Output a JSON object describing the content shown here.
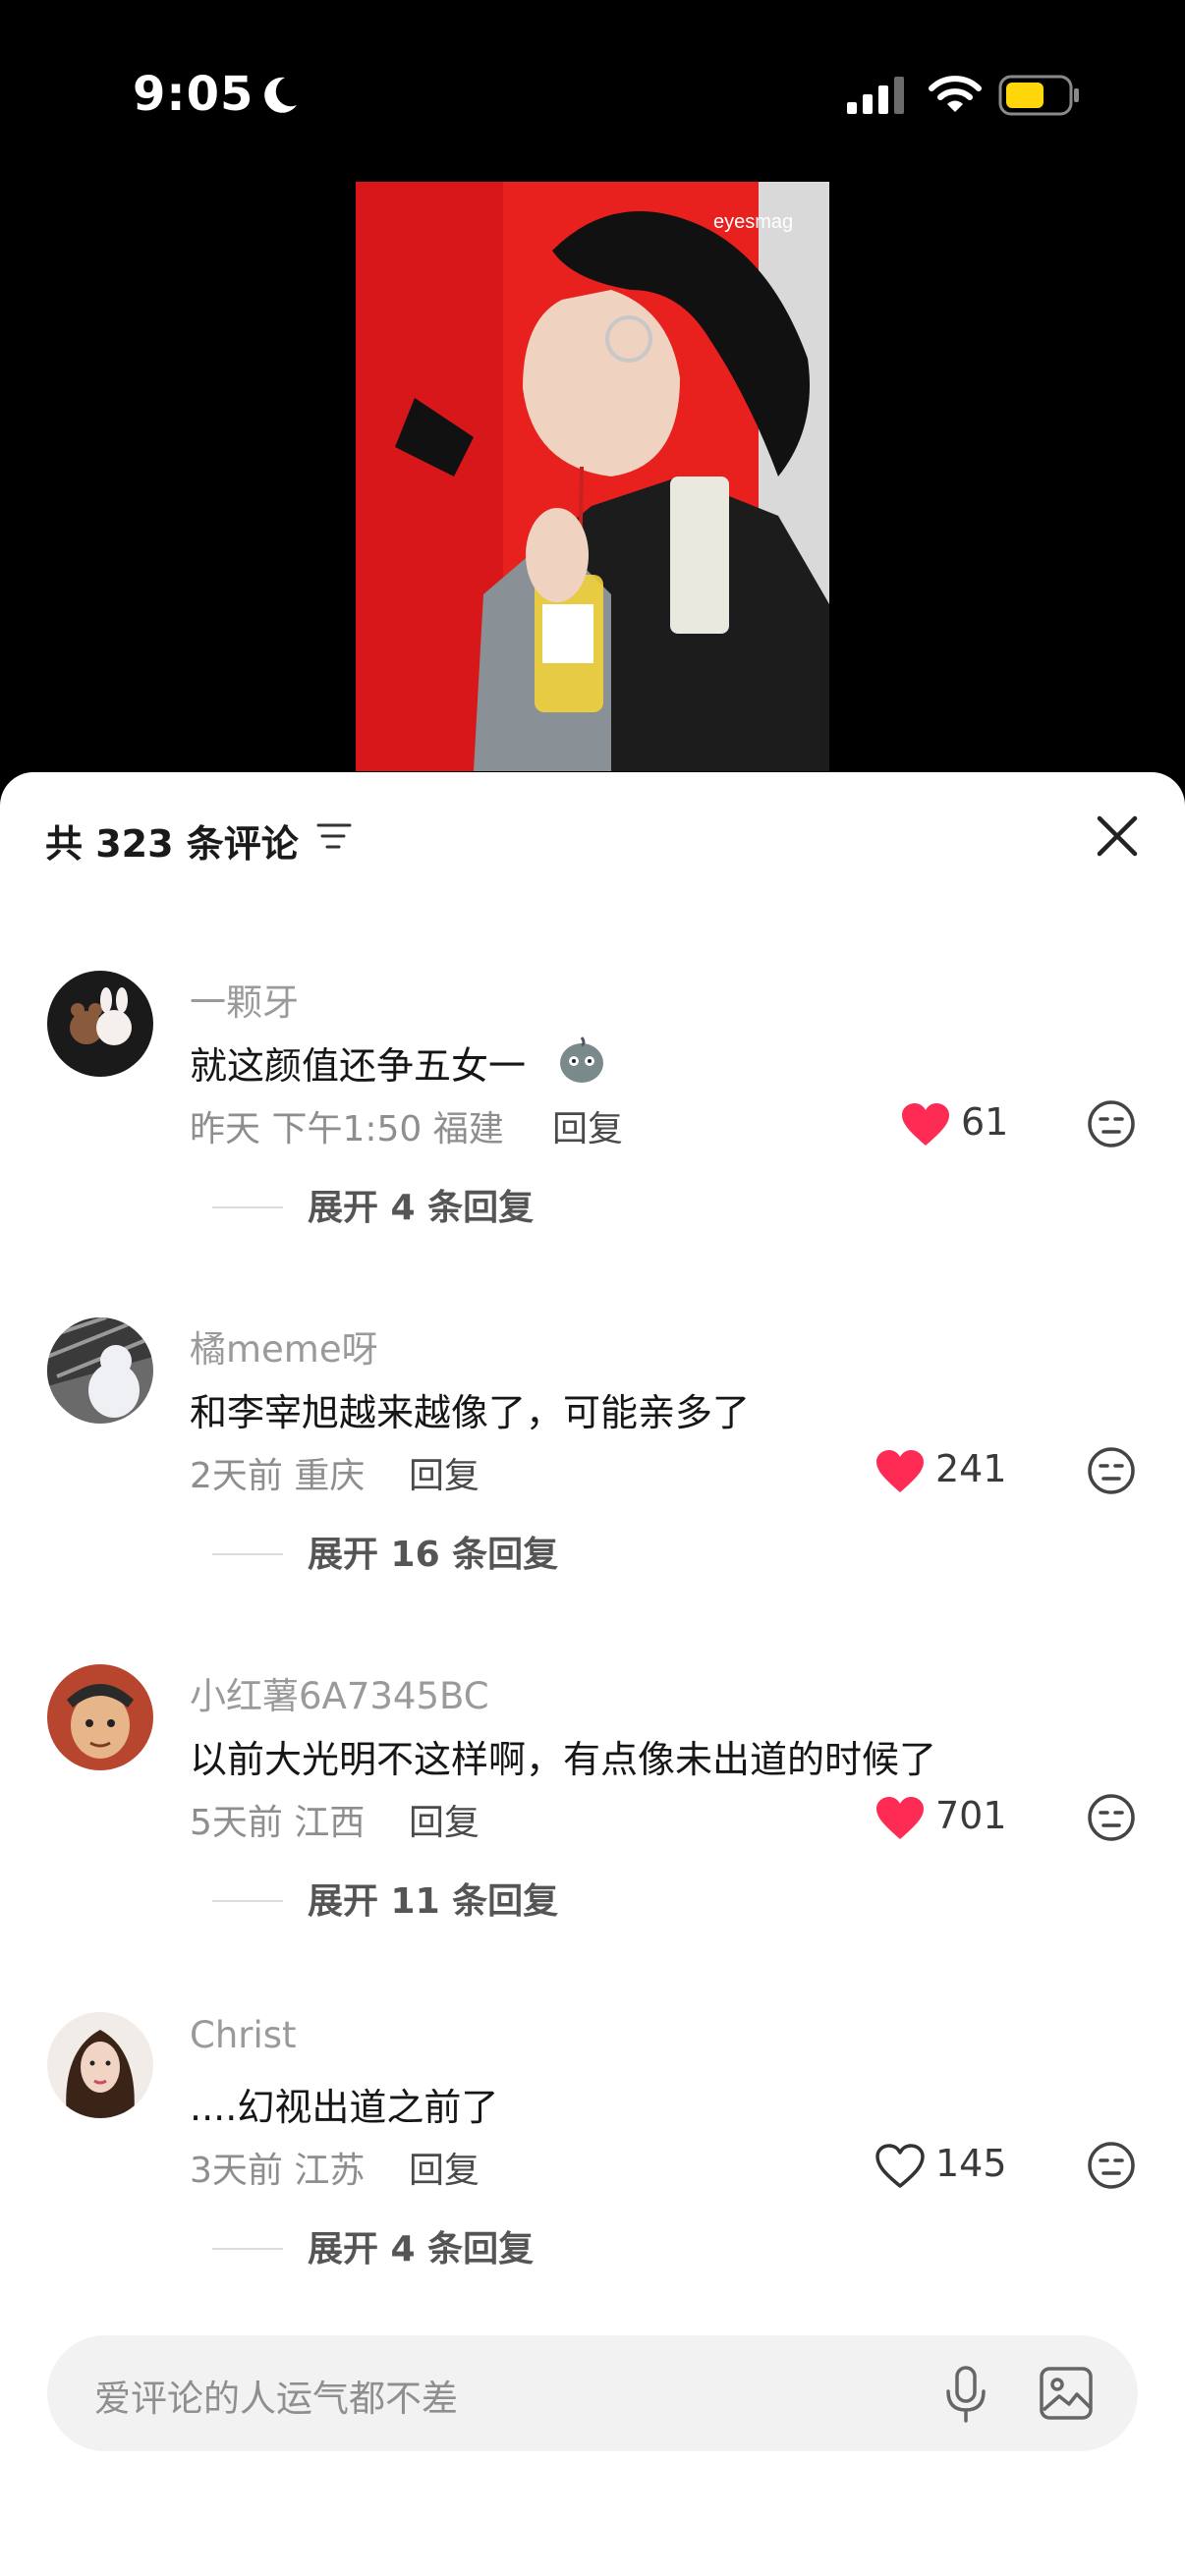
{
  "status_bar": {
    "time": "9:05"
  },
  "video": {
    "watermark": "eyesmag"
  },
  "comments_header": {
    "title": "共 323 条评论"
  },
  "comments": [
    {
      "username": "一颗牙",
      "text": "就这颜值还争五女一",
      "meta": "昨天 下午1:50 福建",
      "reply_label": "回复",
      "likes": "61",
      "liked": true,
      "expand": "展开 4 条回复"
    },
    {
      "username": "橘meme呀",
      "text": "和李宰旭越来越像了，可能亲多了",
      "meta": "2天前 重庆",
      "reply_label": "回复",
      "likes": "241",
      "liked": true,
      "expand": "展开 16 条回复"
    },
    {
      "username": "小红薯6A7345BC",
      "text": "以前大光明不这样啊，有点像未出道的时候了",
      "meta": "5天前 江西",
      "reply_label": "回复",
      "likes": "701",
      "liked": true,
      "expand": "展开 11 条回复"
    },
    {
      "username": "Christ",
      "text": "....幻视出道之前了",
      "meta": "3天前 江苏",
      "reply_label": "回复",
      "likes": "145",
      "liked": false,
      "expand": "展开 4 条回复"
    }
  ],
  "input": {
    "placeholder": "爱评论的人运气都不差"
  },
  "colors": {
    "like_red": "#fe2c55",
    "sheet_bg": "#ffffff",
    "input_bg": "#f2f2f2"
  }
}
